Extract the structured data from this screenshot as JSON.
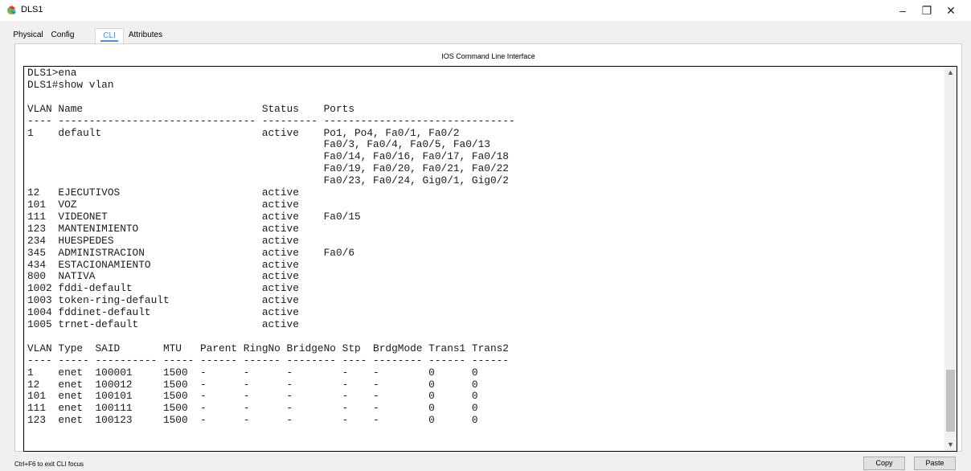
{
  "window": {
    "title": "DLS1",
    "minimize_glyph": "–",
    "maximize_glyph": "❐",
    "close_glyph": "✕"
  },
  "tabs": [
    {
      "label": "Physical",
      "active": false
    },
    {
      "label": "Config",
      "active": false
    },
    {
      "label": "CLI",
      "active": true
    },
    {
      "label": "Attributes",
      "active": false
    }
  ],
  "panel": {
    "title": "IOS Command Line Interface"
  },
  "cli": {
    "lines": [
      "DLS1>ena",
      "DLS1#show vlan",
      "",
      "VLAN Name                             Status    Ports",
      "---- -------------------------------- --------- -------------------------------",
      "1    default                          active    Po1, Po4, Fa0/1, Fa0/2",
      "                                                Fa0/3, Fa0/4, Fa0/5, Fa0/13",
      "                                                Fa0/14, Fa0/16, Fa0/17, Fa0/18",
      "                                                Fa0/19, Fa0/20, Fa0/21, Fa0/22",
      "                                                Fa0/23, Fa0/24, Gig0/1, Gig0/2",
      "12   EJECUTIVOS                       active",
      "101  VOZ                              active",
      "111  VIDEONET                         active    Fa0/15",
      "123  MANTENIMIENTO                    active",
      "234  HUESPEDES                        active",
      "345  ADMINISTRACION                   active    Fa0/6",
      "434  ESTACIONAMIENTO                  active",
      "800  NATIVA                           active",
      "1002 fddi-default                     active",
      "1003 token-ring-default               active",
      "1004 fddinet-default                  active",
      "1005 trnet-default                    active",
      "",
      "VLAN Type  SAID       MTU   Parent RingNo BridgeNo Stp  BrdgMode Trans1 Trans2",
      "---- ----- ---------- ----- ------ ------ -------- ---- -------- ------ ------",
      "1    enet  100001     1500  -      -      -        -    -        0      0",
      "12   enet  100012     1500  -      -      -        -    -        0      0",
      "101  enet  100101     1500  -      -      -        -    -        0      0",
      "111  enet  100111     1500  -      -      -        -    -        0      0",
      "123  enet  100123     1500  -      -      -        -    -        0      0"
    ]
  },
  "scroll": {
    "up_glyph": "▲",
    "down_glyph": "▼"
  },
  "footer": {
    "hint": "Ctrl+F6 to exit CLI focus",
    "copy_label": "Copy",
    "paste_label": "Paste"
  },
  "icons": {
    "app_icon": "packet-tracer-icon"
  }
}
